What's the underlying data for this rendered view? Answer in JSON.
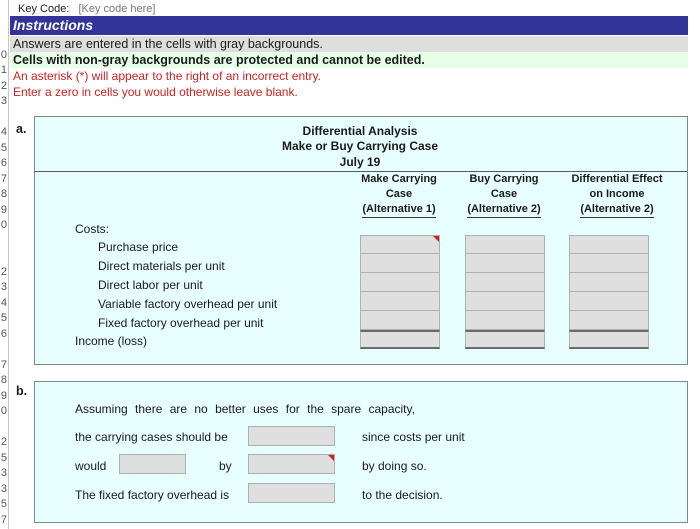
{
  "key_code": {
    "label": "Key Code:",
    "value": "[Key code here]"
  },
  "row_numbers": [
    "",
    "",
    "",
    "0",
    "1",
    "2",
    "3",
    "",
    "4",
    "5",
    "6",
    "7",
    "8",
    "9",
    "0",
    "",
    "",
    "2",
    "3",
    "4",
    "5",
    "6",
    "",
    "7",
    "8",
    "9",
    "0",
    "",
    "2",
    "5",
    "3",
    "3",
    "5",
    "7"
  ],
  "instructions": {
    "title": "Instructions",
    "lines": [
      "Answers are entered in the cells with gray backgrounds.",
      "Cells with non-gray backgrounds are protected and cannot be edited.",
      "An asterisk (*) will appear to the right of an incorrect entry.",
      "Enter a zero in cells you would otherwise leave blank."
    ]
  },
  "part_a": {
    "label": "a.",
    "title_lines": [
      "Differential Analysis",
      "Make or Buy Carrying Case",
      "July 19"
    ],
    "columns": [
      {
        "line1": "Make Carrying",
        "line2": "Case",
        "line3": "(Alternative 1)"
      },
      {
        "line1": "Buy Carrying",
        "line2": "Case",
        "line3": "(Alternative 2)"
      },
      {
        "line1": "Differential Effect",
        "line2": "on Income",
        "line3": "(Alternative 2)"
      }
    ],
    "costs_label": "Costs:",
    "rows": [
      "Purchase price",
      "Direct materials per unit",
      "Direct labor per unit",
      "Variable factory overhead per unit",
      "Fixed factory overhead per unit"
    ],
    "total_label": "Income (loss)",
    "values": [
      [
        "",
        "",
        "",
        "",
        "",
        ""
      ],
      [
        "",
        "",
        "",
        "",
        "",
        ""
      ],
      [
        "",
        "",
        "",
        "",
        "",
        ""
      ]
    ]
  },
  "part_b": {
    "label": "b.",
    "sentence1": "Assuming there are no better uses for the spare capacity,",
    "line2_prefix": "the carrying cases should be",
    "line2_suffix": "since costs per unit",
    "line3_prefix": "would",
    "line3_mid": "by",
    "line3_suffix": "by doing so.",
    "line4_prefix": "The fixed factory overhead is",
    "line4_suffix": "to the decision.",
    "inputs": {
      "should_be": "",
      "would": "",
      "by_amount": "",
      "overhead_is": ""
    }
  }
}
